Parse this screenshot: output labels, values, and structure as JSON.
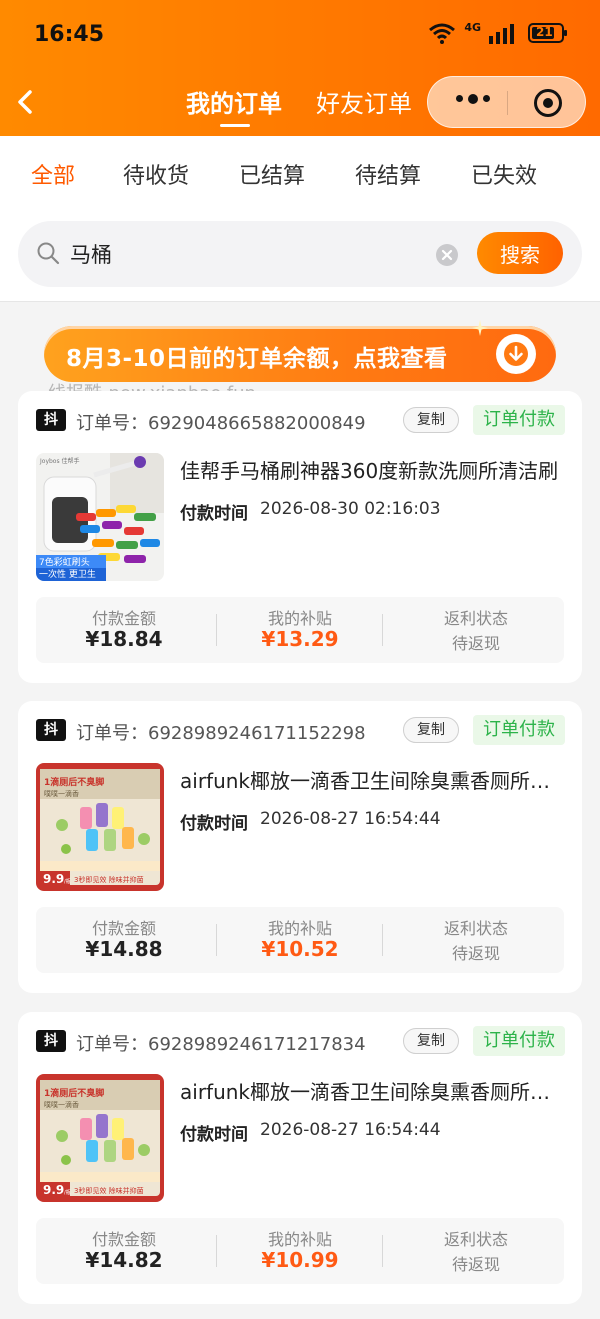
{
  "status_bar": {
    "time": "16:45",
    "network": "4G",
    "battery": "21"
  },
  "nav": {
    "tabs": [
      "我的订单",
      "好友订单"
    ]
  },
  "filter_tabs": [
    "全部",
    "待收货",
    "已结算",
    "待结算",
    "已失效"
  ],
  "search": {
    "value": "马桶",
    "button": "搜索"
  },
  "banner": {
    "text": "8月3-10日前的订单余额，点我查看"
  },
  "watermark": "线报酷-new.xianbao.fun",
  "colors": {
    "brand_orange": "#ff6a00",
    "status_green": "#2db34a",
    "subsidy_orange": "#ff5a14"
  },
  "order_labels": {
    "platform": "抖",
    "order_no_prefix": "订单号：",
    "copy": "复制",
    "pay_time": "付款时间",
    "pay_amount": "付款金额",
    "subsidy": "我的补贴",
    "rebate_status": "返利状态"
  },
  "orders": [
    {
      "order_no": "6929048665882000849",
      "status": "订单付款",
      "title": "佳帮手马桶刷神器360度新款洗厕所清洁刷",
      "pay_time": "2026-08-30 02:16:03",
      "pay_amount": "¥18.84",
      "subsidy": "¥13.29",
      "rebate_status": "待返现",
      "img_brand": "Joybos 佳帮手",
      "img_caption1": "7色彩虹刷头",
      "img_caption2": "一次性 更卫生"
    },
    {
      "order_no": "6928989246171152298",
      "status": "订单付款",
      "title": "airfunk椰放一滴香卫生间除臭熏香厕所香氛",
      "pay_time": "2026-08-27 16:54:44",
      "pay_amount": "¥14.88",
      "subsidy": "¥10.52",
      "rebate_status": "待返现",
      "img_headline": "1滴厕后不臭脚",
      "img_sub": "噗噗一滴香",
      "img_price": "9.9",
      "img_unit": "/瓶",
      "img_caption": "3秒即见效 除味并抑菌"
    },
    {
      "order_no": "6928989246171217834",
      "status": "订单付款",
      "title": "airfunk椰放一滴香卫生间除臭熏香厕所香氛",
      "pay_time": "2026-08-27 16:54:44",
      "pay_amount": "¥14.82",
      "subsidy": "¥10.99",
      "rebate_status": "待返现",
      "img_headline": "1滴厕后不臭脚",
      "img_sub": "噗噗一滴香",
      "img_price": "9.9",
      "img_unit": "/瓶",
      "img_caption": "3秒即见效 除味并抑菌"
    }
  ]
}
